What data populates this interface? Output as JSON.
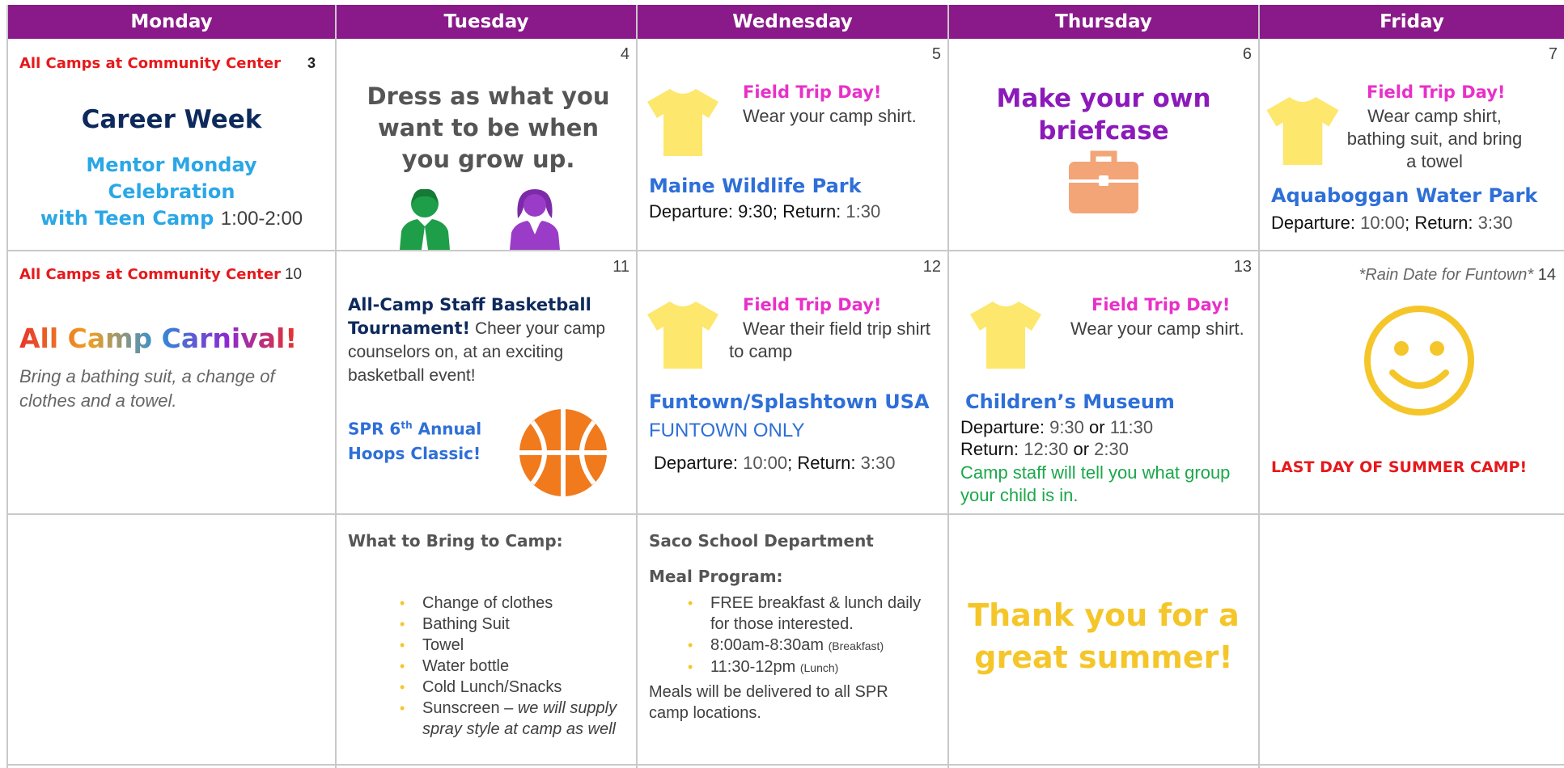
{
  "days": [
    "Monday",
    "Tuesday",
    "Wednesday",
    "Thursday",
    "Friday"
  ],
  "week1": {
    "mon": {
      "location": "All Camps at Community Center",
      "num": "3",
      "theme": "Career Week",
      "event_line1": "Mentor Monday",
      "event_line2": "Celebration",
      "event_line3": "with Teen Camp",
      "time": "1:00-2:00"
    },
    "tue": {
      "num": "4",
      "text": "Dress as what you want to be when you grow up."
    },
    "wed": {
      "num": "5",
      "trip": "Field Trip Day!",
      "note": "Wear your camp shirt.",
      "place": "Maine Wildlife Park",
      "dep_label": "Departure:",
      "dep": "9:30",
      "ret_label": "Return:",
      "ret": "1:30"
    },
    "thu": {
      "num": "6",
      "text": "Make your own briefcase"
    },
    "fri": {
      "num": "7",
      "trip": "Field Trip Day!",
      "note": "Wear camp shirt, bathing suit, and bring a towel",
      "place": "Aquaboggan Water Park",
      "dep_label": "Departure:",
      "dep": "10:00",
      "ret_label": "Return:",
      "ret": "3:30"
    }
  },
  "week2": {
    "mon": {
      "location": "All Camps at Community Center",
      "num": "10",
      "title": "All Camp Carnival!",
      "note": "Bring a bathing suit, a change of clothes and a towel."
    },
    "tue": {
      "num": "11",
      "title": "All-Camp Staff Basketball Tournament!",
      "note": "Cheer your camp counselors on, at an exciting basketball event!",
      "spr": "SPR 6",
      "sup": "th",
      "spr_rest": "Annual",
      "hoops": "Hoops Classic!"
    },
    "wed": {
      "num": "12",
      "trip": "Field Trip Day!",
      "note": "Wear their field trip shirt to camp",
      "place": "Funtown/Splashtown USA",
      "only": "FUNTOWN ONLY",
      "dep_label": "Departure:",
      "dep": "10:00",
      "ret_label": "Return:",
      "ret": "3:30"
    },
    "thu": {
      "num": "13",
      "trip": "Field Trip Day!",
      "note": "Wear your camp shirt.",
      "place": "Children’s Museum",
      "dep_label": "Departure:",
      "dep1": "9:30",
      "or": "or",
      "dep2": "11:30",
      "ret_label": "Return:",
      "ret1": "12:30",
      "ret2": "2:30",
      "staff": "Camp staff will tell you what group your child is in."
    },
    "fri": {
      "rain": "*Rain Date for Funtown*",
      "num": "14",
      "last": "LAST DAY OF SUMMER CAMP!"
    }
  },
  "week3": {
    "tue": {
      "title": "What to Bring to Camp:",
      "items": [
        "Change of clothes",
        "Bathing Suit",
        "Towel",
        "Water bottle",
        "Cold Lunch/Snacks"
      ],
      "sunscreen": "Sunscreen –",
      "sunscreen_note": "we will supply spray style at camp as well"
    },
    "wed": {
      "title": "Saco School Department",
      "subtitle": "Meal Program:",
      "item1": "FREE breakfast & lunch daily for those interested.",
      "item2": "8:00am-8:30am",
      "item2_note": "(Breakfast)",
      "item3": "11:30-12pm",
      "item3_note": "(Lunch)",
      "footer": "Meals will be delivered to all SPR camp locations."
    },
    "thu": {
      "text": "Thank you for a great summer!"
    }
  },
  "colors": {
    "header": "#8a1a8a",
    "red": "#e6191c",
    "blue": "#2e6fd8",
    "pink": "#e830c8",
    "gold": "#f5c62a",
    "green": "#1ba84a",
    "orange": "#f07a1c",
    "briefcase": "#f3a578"
  }
}
